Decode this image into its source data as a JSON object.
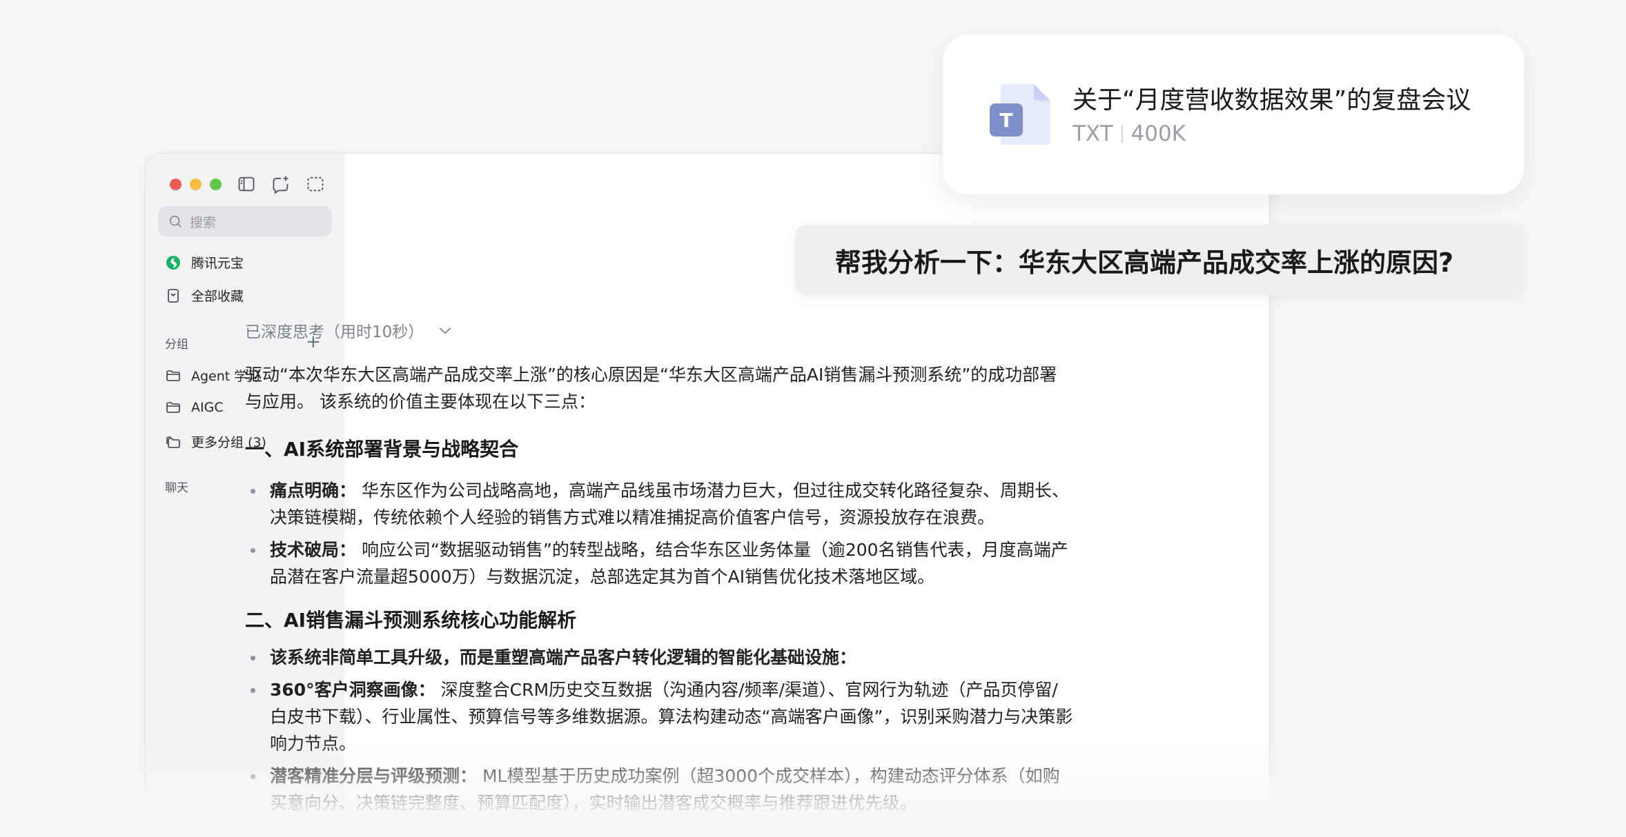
{
  "colors": {
    "accent_green": "#17b26a",
    "traffic_red": "#ee5b55",
    "traffic_yellow": "#f4bd3f",
    "traffic_green": "#5fc64a",
    "file_icon_blue": "#7e8fc9"
  },
  "sidebar": {
    "search_placeholder": "搜索",
    "items": [
      {
        "label": "腾讯元宝",
        "icon": "yuanbao-logo-icon"
      },
      {
        "label": "全部收藏",
        "icon": "bookmark-icon"
      }
    ],
    "group_label": "分组",
    "groups": [
      {
        "label": "Agent 学习",
        "icon": "folder-icon"
      },
      {
        "label": "AIGC",
        "icon": "folder-icon"
      },
      {
        "label": "更多分组 (3)",
        "icon": "folders-icon"
      }
    ],
    "chat_label": "聊天"
  },
  "file_card": {
    "title": "关于“月度营收数据效果”的复盘会议",
    "type": "TXT",
    "size": "400K",
    "icon": "txt-file-icon",
    "icon_letter": "T"
  },
  "question": "帮我分析一下：华东大区高端产品成交率上涨的原因?",
  "answer": {
    "thinking": "已深度思考（用时10秒）",
    "intro": "驱动“本次华东大区高端产品成交率上涨”的核心原因是“华东大区高端产品AI销售漏斗预测系统”的成功部署与应用。 该系统的价值主要体现在以下三点：",
    "section1": {
      "title": "一、AI系统部署背景与战略契合",
      "bullets": [
        {
          "bold": "痛点明确：",
          "text": " 华东区作为公司战略高地，高端产品线虽市场潜力巨大，但过往成交转化路径复杂、周期长、决策链模糊，传统依赖个人经验的销售方式难以精准捕捉高价值客户信号，资源投放存在浪费。"
        },
        {
          "bold": "技术破局：",
          "text": " 响应公司“数据驱动销售”的转型战略，结合华东区业务体量（逾200名销售代表，月度高端产品潜在客户流量超5000万）与数据沉淀，总部选定其为首个AI销售优化技术落地区域。"
        }
      ]
    },
    "section2": {
      "title": "二、AI销售漏斗预测系统核心功能解析",
      "bullets": [
        {
          "bold": "该系统非简单工具升级，而是重塑高端产品客户转化逻辑的智能化基础设施：",
          "text": ""
        },
        {
          "bold": "360°客户洞察画像：",
          "text": " 深度整合CRM历史交互数据（沟通内容/频率/渠道）、官网行为轨迹（产品页停留/白皮书下载）、行业属性、预算信号等多维数据源。算法构建动态“高端客户画像”，识别采购潜力与决策影响力节点。"
        },
        {
          "bold": "潜客精准分层与评级预测：",
          "text": " ML模型基于历史成功案例（超3000个成交样本），构建动态评分体系（如购买意向分、决策链完整度、预算匹配度），实时输出潜客成交概率与推荐跟进优先级。"
        }
      ]
    }
  }
}
